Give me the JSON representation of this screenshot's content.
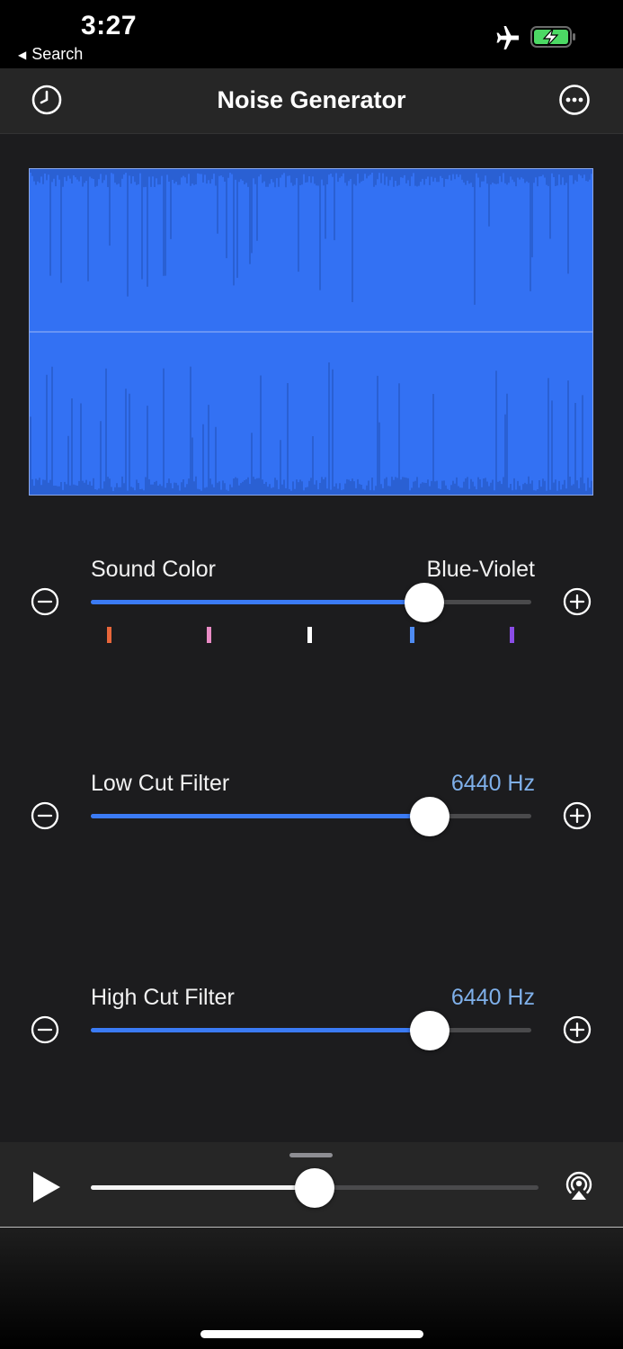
{
  "status_bar": {
    "time": "3:27",
    "back_label": "Search",
    "back_arrow": "◀",
    "icons": [
      "airplane-icon",
      "battery-charging-icon"
    ],
    "battery_color": "#4cd964"
  },
  "nav": {
    "title": "Noise Generator",
    "left_icon": "clock-icon",
    "right_icon": "more-icon"
  },
  "waveform": {
    "fill_color": "#3371f3"
  },
  "sliders": [
    {
      "id": "sound-color",
      "label": "Sound Color",
      "value_text": "Blue-Violet",
      "value_color": "#f2f2f2",
      "fraction": 0.758,
      "ticks": [
        {
          "color": "#e8663a",
          "fraction": 0.04
        },
        {
          "color": "#e98bc5",
          "fraction": 0.268
        },
        {
          "color": "#ffffff",
          "fraction": 0.496
        },
        {
          "color": "#4e8bf2",
          "fraction": 0.728
        },
        {
          "color": "#8a4ce6",
          "fraction": 0.956
        }
      ]
    },
    {
      "id": "low-cut",
      "label": "Low Cut Filter",
      "value_text": "6440 Hz",
      "value_color": "#7fb0ea",
      "fraction": 0.769,
      "ticks": []
    },
    {
      "id": "high-cut",
      "label": "High Cut Filter",
      "value_text": "6440 Hz",
      "value_color": "#7fb0ea",
      "fraction": 0.769,
      "ticks": []
    }
  ],
  "player": {
    "play_icon": "play-icon",
    "volume_fraction": 0.5,
    "airplay_icon": "airplay-icon"
  },
  "colors": {
    "accent": "#3b7bf5",
    "panel": "#1c1c1e",
    "bar": "#262626"
  }
}
